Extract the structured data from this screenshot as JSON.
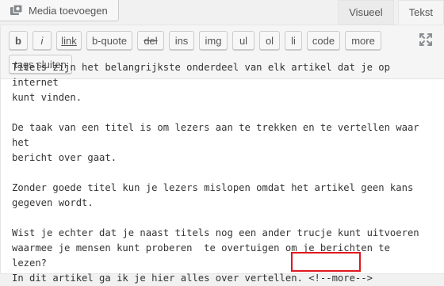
{
  "toolbar_top": {
    "media_button_label": "Media toevoegen",
    "tabs": [
      {
        "label": "Visueel",
        "active": false
      },
      {
        "label": "Tekst",
        "active": true
      }
    ]
  },
  "quicktags": {
    "buttons": [
      {
        "label": "b"
      },
      {
        "label": "i"
      },
      {
        "label": "link"
      },
      {
        "label": "b-quote"
      },
      {
        "label": "del"
      },
      {
        "label": "ins"
      },
      {
        "label": "img"
      },
      {
        "label": "ul"
      },
      {
        "label": "ol"
      },
      {
        "label": "li"
      },
      {
        "label": "code"
      },
      {
        "label": "more"
      },
      {
        "label": "tags sluiten"
      }
    ],
    "fullscreen_icon": "expand-icon"
  },
  "content": {
    "paragraphs": [
      "Titels zijn het belangrijkste onderdeel van elk artikel dat je op internet\nkunt vinden.",
      "De taak van een titel is om lezers aan te trekken en te vertellen waar het\nbericht over gaat.",
      "Zonder goede titel kun je lezers mislopen omdat het artikel geen kans\ngegeven wordt.",
      "Wist je echter dat je naast titels nog een ander trucje kunt uitvoeren\nwaarmee je mensen kunt proberen  te overtuigen om je berichten te lezen?\nIn dit artikel ga ik je hier alles over vertellen."
    ],
    "more_tag": "<!--more-->"
  },
  "colors": {
    "highlight_border": "#e0161f",
    "background": "#f1f1f1"
  }
}
